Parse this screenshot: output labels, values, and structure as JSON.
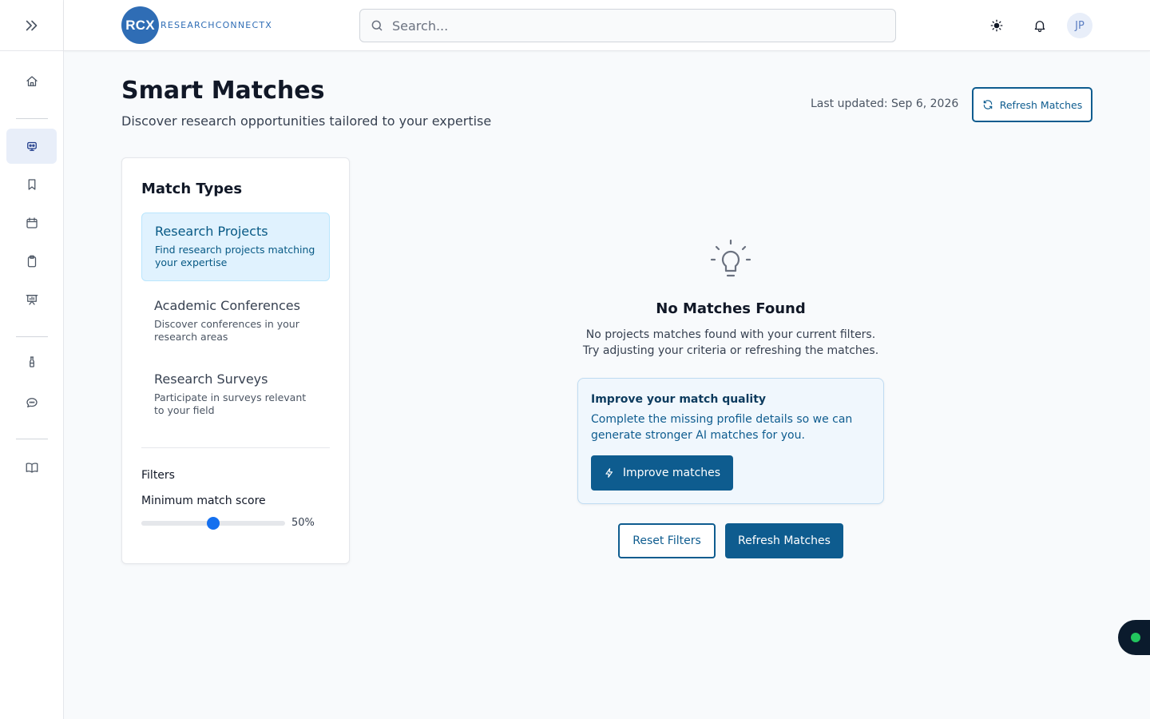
{
  "rail": {
    "items": [
      {
        "name": "home",
        "icon": "home-icon"
      },
      {
        "name": "smart-matches",
        "icon": "robot-icon",
        "active": true
      },
      {
        "name": "saved",
        "icon": "bookmark-icon"
      },
      {
        "name": "calendar",
        "icon": "calendar-icon"
      },
      {
        "name": "clipboard",
        "icon": "clipboard-icon"
      },
      {
        "name": "presentation",
        "icon": "presentation-icon"
      },
      {
        "name": "lab",
        "icon": "flask-icon"
      },
      {
        "name": "messages",
        "icon": "chat-icon"
      },
      {
        "name": "library",
        "icon": "book-icon"
      }
    ]
  },
  "header": {
    "logo_mark": "RCX",
    "logo_text": "RESEARCHCONNECTX",
    "search_placeholder": "Search...",
    "avatar_initials": "JP"
  },
  "page": {
    "title": "Smart Matches",
    "subtitle": "Discover research opportunities tailored to your expertise",
    "last_updated": "Last updated: Sep 6, 2026",
    "refresh_top_label": "Refresh Matches"
  },
  "match_types": {
    "title": "Match Types",
    "items": [
      {
        "name": "Research Projects",
        "description": "Find research projects matching your expertise",
        "active": true
      },
      {
        "name": "Academic Conferences",
        "description": "Discover conferences in your research areas",
        "active": false
      },
      {
        "name": "Research Surveys",
        "description": "Participate in surveys relevant to your field",
        "active": false
      }
    ],
    "filters_title": "Filters",
    "min_score_label": "Minimum match score",
    "min_score_value": 50,
    "min_score_text": "50%"
  },
  "empty_state": {
    "title": "No Matches Found",
    "line1": "No projects matches found with your current filters.",
    "line2": "Try adjusting your criteria or refreshing the matches.",
    "improve_title": "Improve your match quality",
    "improve_text": "Complete the missing profile details so we can generate stronger AI matches for you.",
    "improve_button": "Improve matches",
    "reset_button": "Reset Filters",
    "refresh_button": "Refresh Matches"
  },
  "colors": {
    "primary": "#0e5c8f",
    "brand": "#2f6db5",
    "slider_thumb": "#1570ef",
    "status_online": "#22c55e"
  }
}
